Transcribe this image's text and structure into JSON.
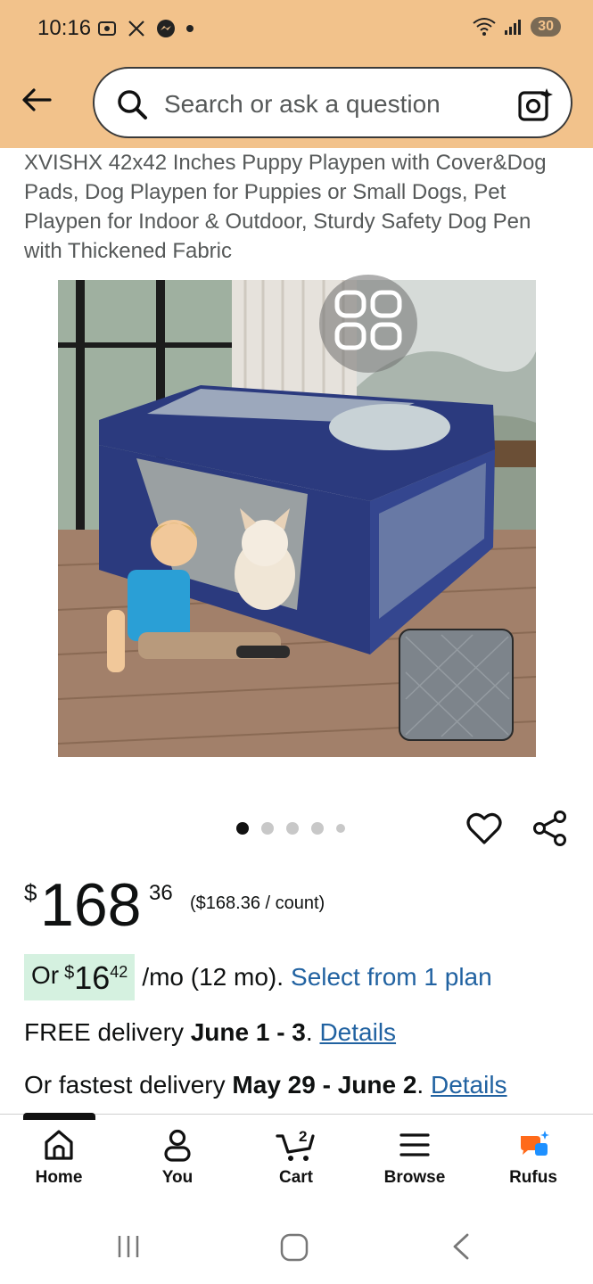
{
  "status_bar": {
    "time": "10:16",
    "battery": "30"
  },
  "search": {
    "placeholder": "Search or ask a question"
  },
  "product": {
    "title": "XVISHX 42x42 Inches Puppy Playpen with Cover&Dog Pads, Dog Playpen for Puppies or Small Dogs, Pet Playpen for Indoor & Outdoor, Sturdy Safety Dog Pen with Thickened Fabric",
    "image_count": 5,
    "active_image_index": 0
  },
  "price": {
    "symbol": "$",
    "whole": "168",
    "fraction": "36",
    "unit_price": "($168.36 / count)"
  },
  "monthly": {
    "prefix": "Or",
    "symbol": "$",
    "whole": "16",
    "fraction": "42",
    "term": "/mo (12 mo).",
    "link": "Select from 1 plan"
  },
  "delivery": {
    "free_prefix": "FREE delivery",
    "free_dates": "June 1 - 3",
    "free_link": "Details",
    "fast_prefix": "Or fastest delivery",
    "fast_dates": "May 29 - June 2",
    "fast_link": "Details"
  },
  "bottom_nav": {
    "home": "Home",
    "you": "You",
    "cart": "Cart",
    "cart_count": "2",
    "browse": "Browse",
    "rufus": "Rufus"
  },
  "colors": {
    "header_bg": "#f2c28b",
    "link": "#2162a1",
    "monthly_pill": "#d5f1e0",
    "playpen_blue": "#2b3a7e",
    "rufus_orange": "#ff6a1a",
    "rufus_blue": "#1e90ff"
  }
}
